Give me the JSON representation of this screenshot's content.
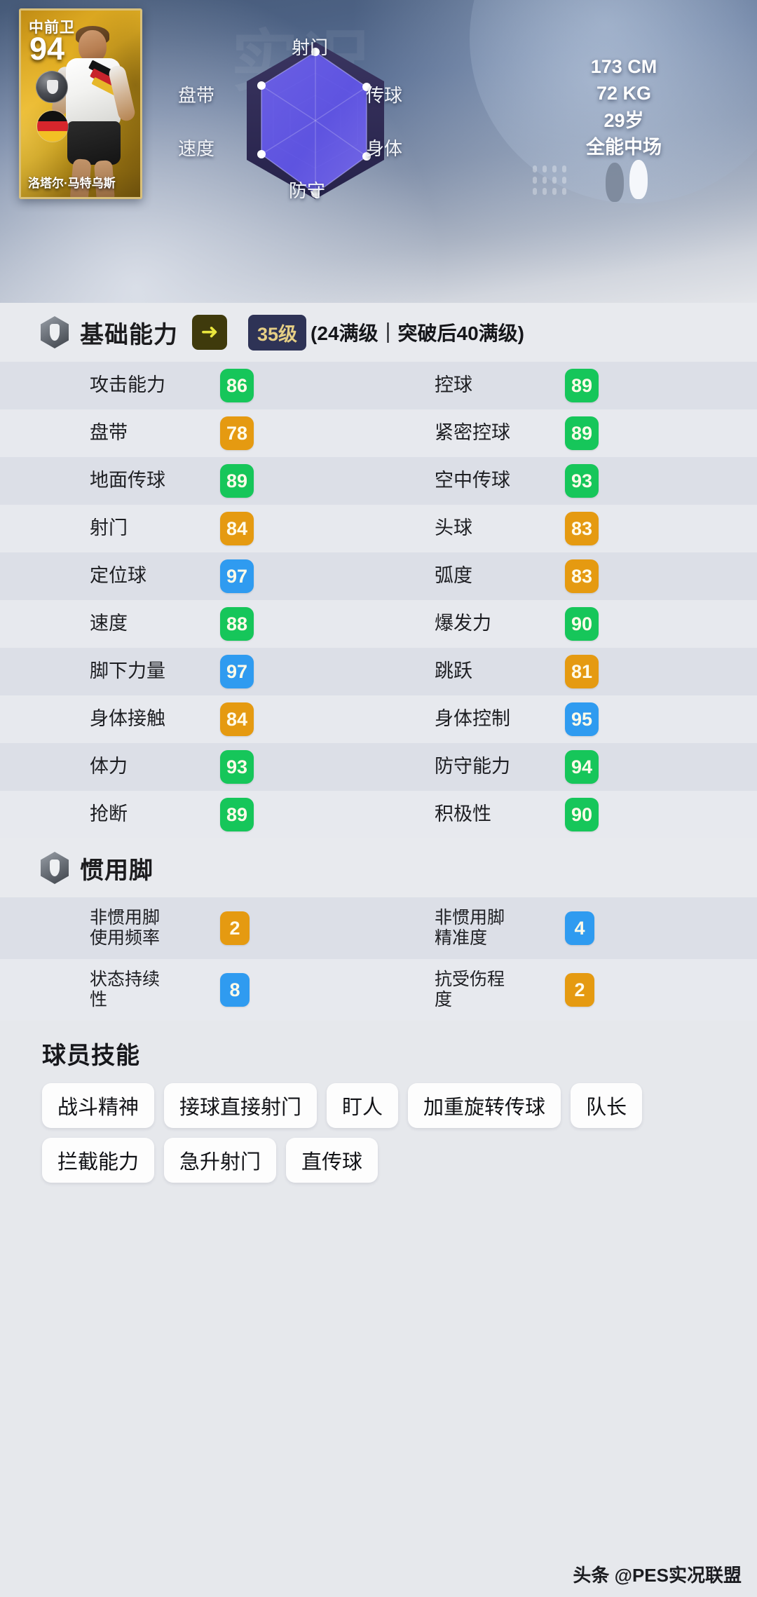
{
  "card": {
    "position": "中前卫",
    "rating": "94",
    "name": "洛塔尔·马特乌斯",
    "nation": "德国"
  },
  "radar": {
    "labels": {
      "shooting": "射门",
      "passing": "传球",
      "physical": "身体",
      "defending": "防守",
      "speed": "速度",
      "dribbling": "盘带"
    }
  },
  "physical": {
    "height": "173 CM",
    "weight": "72 KG",
    "age": "29岁",
    "playstyle": "全能中场"
  },
  "base_section": {
    "icon": "hexagon-player-icon",
    "title": "基础能力",
    "arrow": "➜",
    "level": "35级",
    "level_note": "(24满级｜突破后40满级)"
  },
  "base_stats": [
    {
      "left": {
        "label": "攻击能力",
        "value": "86",
        "color": "green"
      },
      "right": {
        "label": "控球",
        "value": "89",
        "color": "green"
      }
    },
    {
      "left": {
        "label": "盘带",
        "value": "78",
        "color": "orange"
      },
      "right": {
        "label": "紧密控球",
        "value": "89",
        "color": "green"
      }
    },
    {
      "left": {
        "label": "地面传球",
        "value": "89",
        "color": "green"
      },
      "right": {
        "label": "空中传球",
        "value": "93",
        "color": "green"
      }
    },
    {
      "left": {
        "label": "射门",
        "value": "84",
        "color": "orange"
      },
      "right": {
        "label": "头球",
        "value": "83",
        "color": "orange"
      }
    },
    {
      "left": {
        "label": "定位球",
        "value": "97",
        "color": "blue"
      },
      "right": {
        "label": "弧度",
        "value": "83",
        "color": "orange"
      }
    },
    {
      "left": {
        "label": "速度",
        "value": "88",
        "color": "green"
      },
      "right": {
        "label": "爆发力",
        "value": "90",
        "color": "green"
      }
    },
    {
      "left": {
        "label": "脚下力量",
        "value": "97",
        "color": "blue"
      },
      "right": {
        "label": "跳跃",
        "value": "81",
        "color": "orange"
      }
    },
    {
      "left": {
        "label": "身体接触",
        "value": "84",
        "color": "orange"
      },
      "right": {
        "label": "身体控制",
        "value": "95",
        "color": "blue"
      }
    },
    {
      "left": {
        "label": "体力",
        "value": "93",
        "color": "green"
      },
      "right": {
        "label": "防守能力",
        "value": "94",
        "color": "green"
      }
    },
    {
      "left": {
        "label": "抢断",
        "value": "89",
        "color": "green"
      },
      "right": {
        "label": "积极性",
        "value": "90",
        "color": "green"
      }
    }
  ],
  "foot_section": {
    "icon": "hexagon-foot-icon",
    "title": "惯用脚"
  },
  "foot_stats": [
    {
      "left": {
        "label": "非惯用脚\n使用频率",
        "value": "2",
        "color": "orange"
      },
      "right": {
        "label": "非惯用脚\n精准度",
        "value": "4",
        "color": "blue"
      }
    },
    {
      "left": {
        "label": "状态持续\n性",
        "value": "8",
        "color": "blue"
      },
      "right": {
        "label": "抗受伤程\n度",
        "value": "2",
        "color": "orange"
      }
    }
  ],
  "skills_section": {
    "title": "球员技能",
    "items": [
      "战斗精神",
      "接球直接射门",
      "盯人",
      "加重旋转传球",
      "队长",
      "拦截能力",
      "急升射门",
      "直传球"
    ]
  },
  "watermark": "头条 @PES实况联盟",
  "colors": {
    "green": "#16c65a",
    "orange": "#e59a11",
    "blue": "#2f9bf0",
    "level_badge_bg": "#2e3356",
    "level_badge_text": "#e6cf85",
    "arrow_bg": "#3f3a0c",
    "arrow_fg": "#e9e53d",
    "row_odd": "#dcdfe7",
    "row_even": "#e7e9ee",
    "page_bg": "#e6e8ec"
  }
}
